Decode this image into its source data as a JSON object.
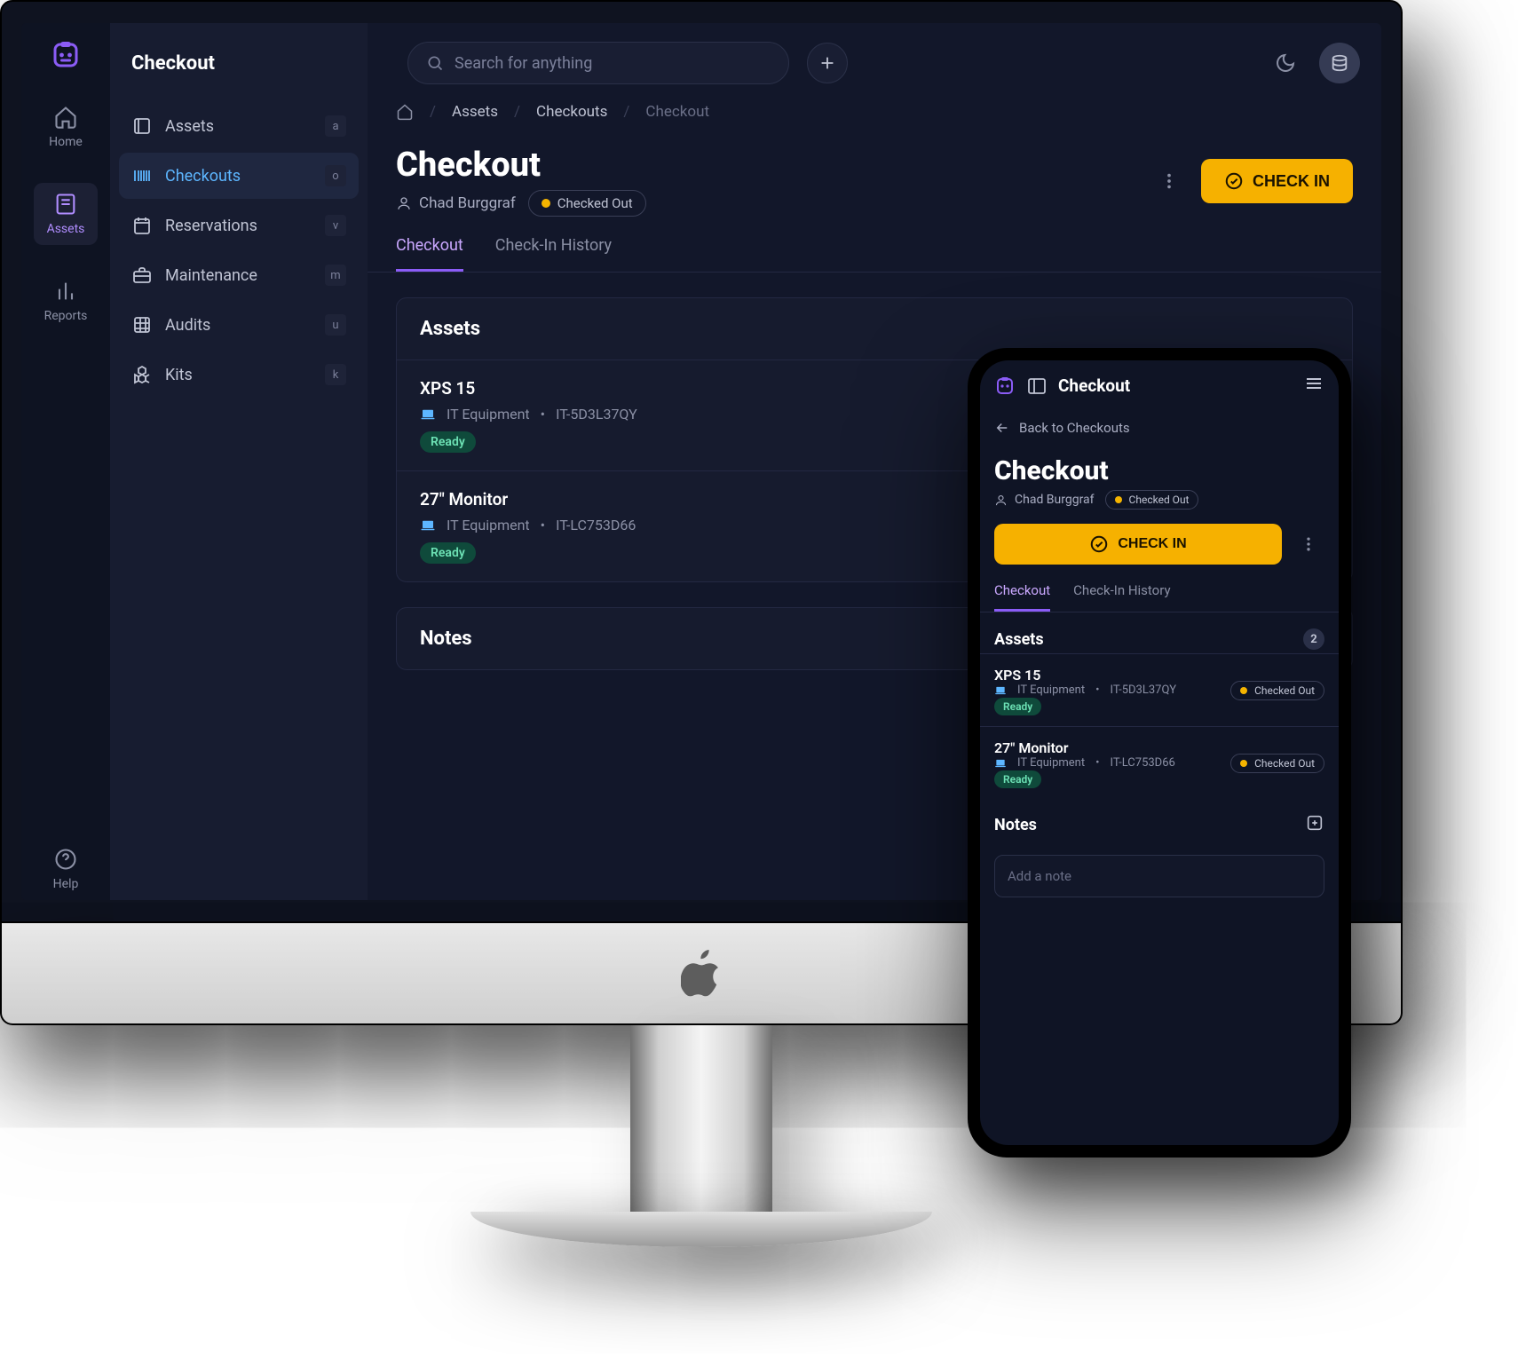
{
  "header": {
    "title": "Checkout",
    "search_placeholder": "Search for anything"
  },
  "rail": {
    "items": [
      {
        "label": "Home"
      },
      {
        "label": "Assets"
      },
      {
        "label": "Reports"
      }
    ],
    "help_label": "Help"
  },
  "sidebar": {
    "items": [
      {
        "label": "Assets",
        "key": "a"
      },
      {
        "label": "Checkouts",
        "key": "o"
      },
      {
        "label": "Reservations",
        "key": "v"
      },
      {
        "label": "Maintenance",
        "key": "m"
      },
      {
        "label": "Audits",
        "key": "u"
      },
      {
        "label": "Kits",
        "key": "k"
      }
    ]
  },
  "breadcrumbs": {
    "b0": "Assets",
    "b1": "Checkouts",
    "b2": "Checkout"
  },
  "page": {
    "title": "Checkout",
    "user": "Chad Burggraf",
    "status": "Checked Out",
    "primary_action": "CHECK IN"
  },
  "tabs": {
    "t0": "Checkout",
    "t1": "Check-In History"
  },
  "section_assets": {
    "title": "Assets",
    "count": "2",
    "rows": [
      {
        "name": "XPS 15",
        "category": "IT Equipment",
        "tag": "IT-5D3L37QY",
        "state": "Ready",
        "status": "Checked Out"
      },
      {
        "name": "27\" Monitor",
        "category": "IT Equipment",
        "tag": "IT-LC753D66",
        "state": "Ready",
        "status": "Checked Out"
      }
    ]
  },
  "section_notes": {
    "title": "Notes",
    "placeholder": "Add a note"
  },
  "mobile": {
    "title": "Checkout",
    "back_label": "Back to Checkouts"
  }
}
